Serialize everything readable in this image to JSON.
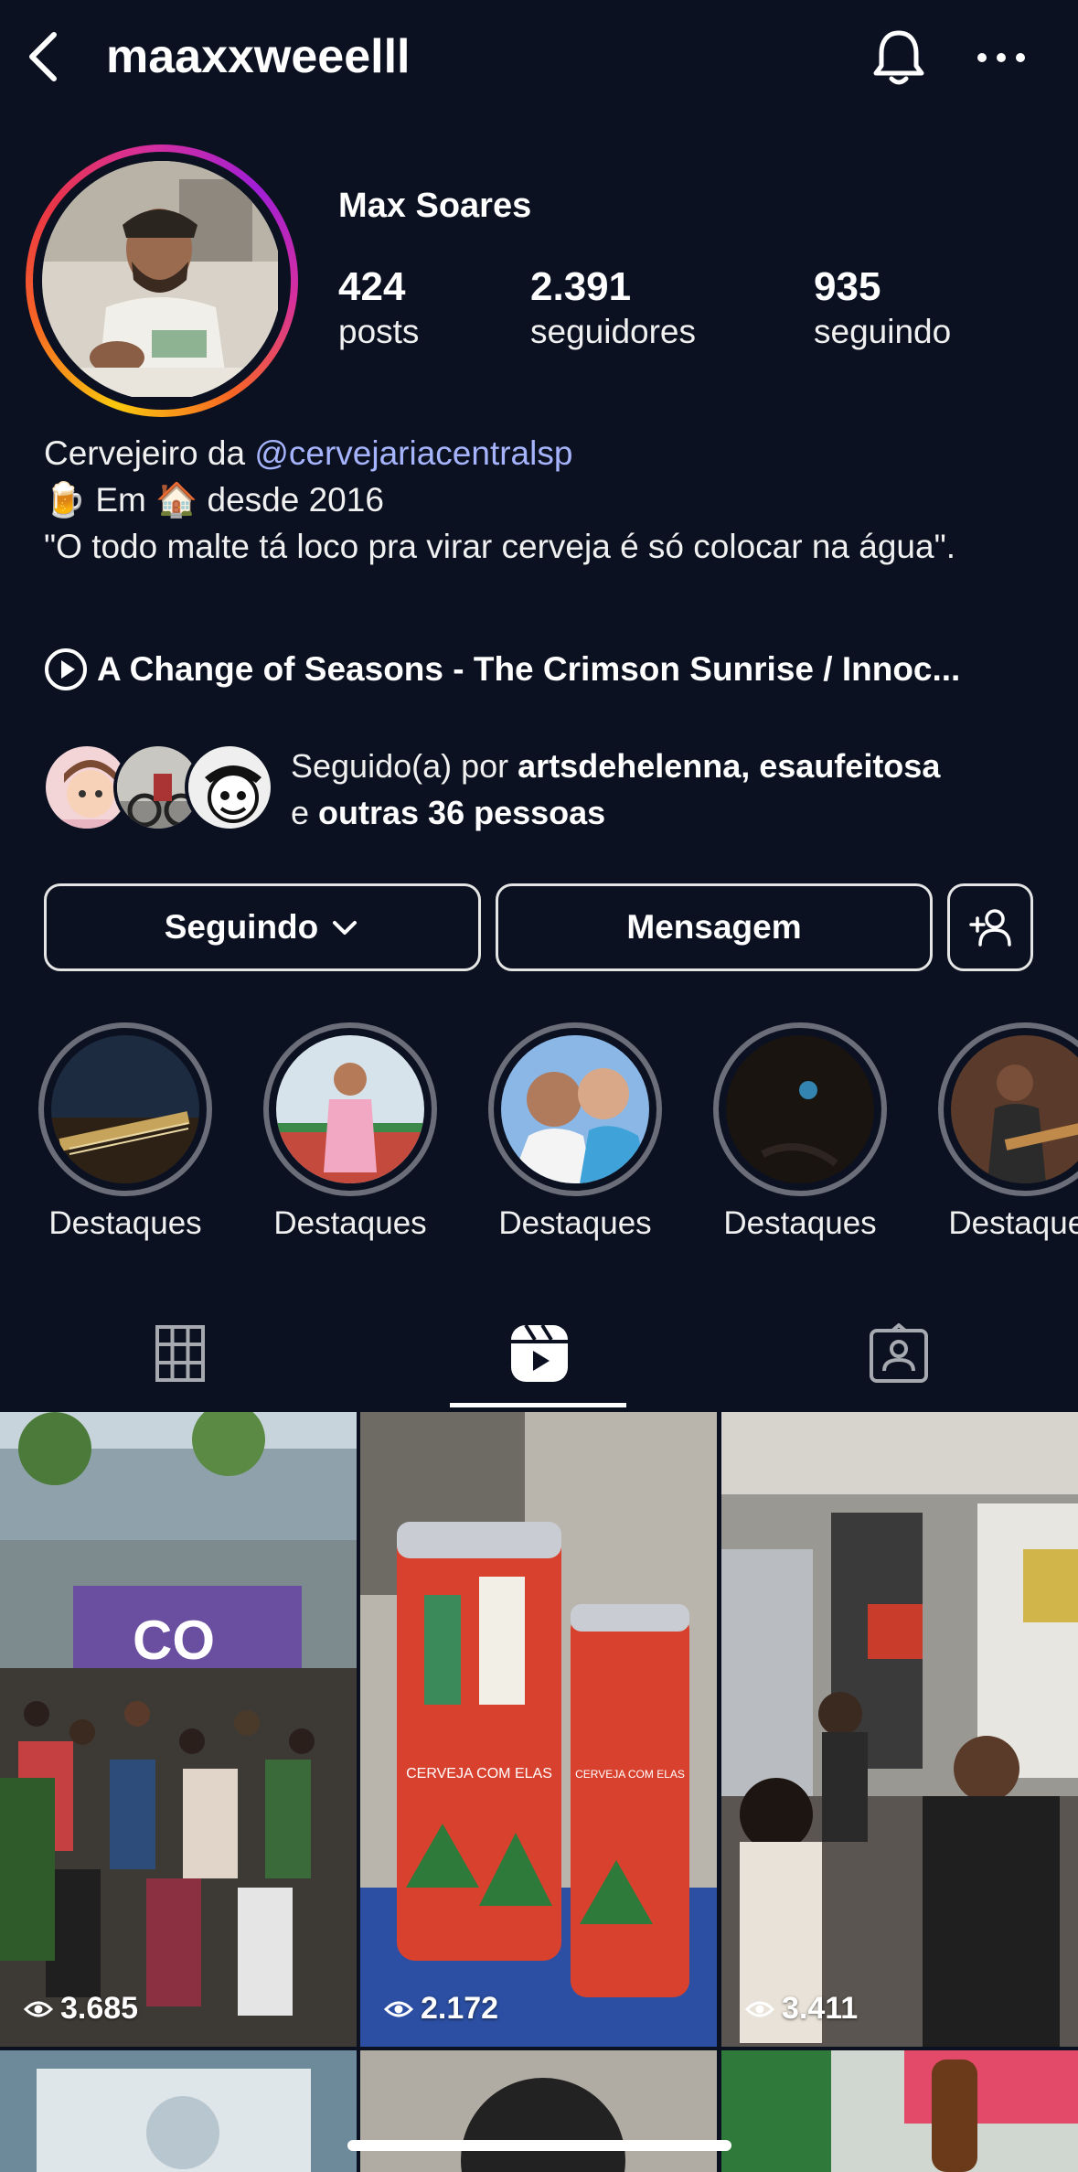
{
  "header": {
    "username": "maaxxweeelll",
    "back_icon": "chevron-left-icon",
    "bell_icon": "bell-icon",
    "more_icon": "ellipsis-icon"
  },
  "profile": {
    "full_name": "Max Soares",
    "stats": [
      {
        "value": "424",
        "label": "posts"
      },
      {
        "value": "2.391",
        "label": "seguidores"
      },
      {
        "value": "935",
        "label": "seguindo"
      }
    ]
  },
  "bio": {
    "line1_prefix": "Cervejeiro da ",
    "line1_mention": "@cervejariacentralsp",
    "line2_emoji_beer": "🍺",
    "line2_em": " Em ",
    "line2_emoji_house": "🏠",
    "line2_since": " desde 2016",
    "quote": "\"O todo malte tá loco pra virar cerveja é só colocar na água\"."
  },
  "music": {
    "track": "A Change of Seasons - The Crimson Sunrise / Innoc..."
  },
  "followed_by": {
    "prefix": "Seguido(a) por ",
    "names": "artsdehelenna, esaufeitosa",
    "connector": "e ",
    "others": "outras 36 pessoas"
  },
  "actions": {
    "following_label": "Seguindo",
    "message_label": "Mensagem"
  },
  "highlights": [
    {
      "label": "Destaques"
    },
    {
      "label": "Destaques"
    },
    {
      "label": "Destaques"
    },
    {
      "label": "Destaques"
    },
    {
      "label": "Destaques"
    }
  ],
  "tabs": [
    {
      "name": "grid",
      "icon": "grid-icon"
    },
    {
      "name": "reels",
      "icon": "reels-icon",
      "active": true
    },
    {
      "name": "tagged",
      "icon": "tagged-icon"
    }
  ],
  "reels": [
    {
      "views": "3.685"
    },
    {
      "views": "2.172"
    },
    {
      "views": "3.411"
    }
  ]
}
